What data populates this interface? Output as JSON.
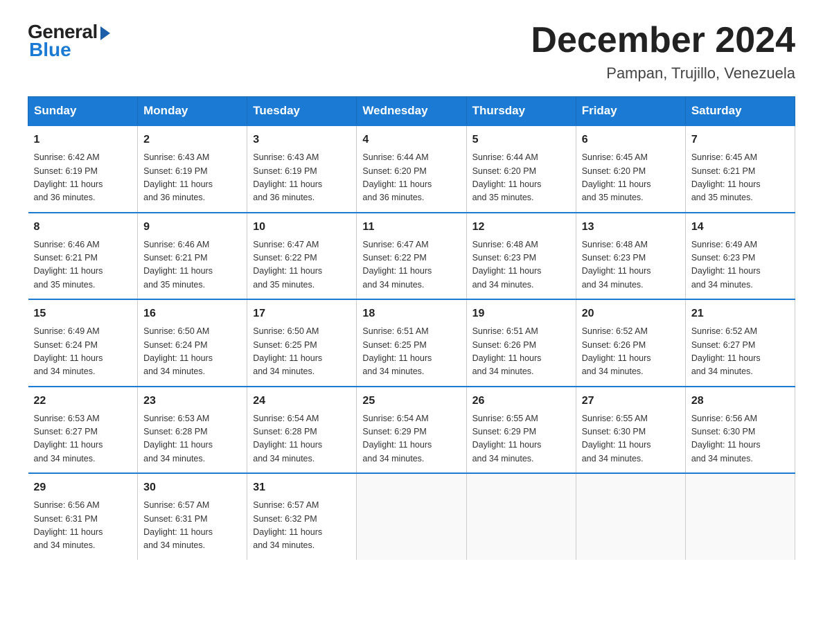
{
  "header": {
    "logo_general": "General",
    "logo_blue": "Blue",
    "month_title": "December 2024",
    "location": "Pampan, Trujillo, Venezuela"
  },
  "calendar": {
    "days_of_week": [
      "Sunday",
      "Monday",
      "Tuesday",
      "Wednesday",
      "Thursday",
      "Friday",
      "Saturday"
    ],
    "weeks": [
      [
        {
          "day": "1",
          "sunrise": "6:42 AM",
          "sunset": "6:19 PM",
          "daylight": "11 hours and 36 minutes."
        },
        {
          "day": "2",
          "sunrise": "6:43 AM",
          "sunset": "6:19 PM",
          "daylight": "11 hours and 36 minutes."
        },
        {
          "day": "3",
          "sunrise": "6:43 AM",
          "sunset": "6:19 PM",
          "daylight": "11 hours and 36 minutes."
        },
        {
          "day": "4",
          "sunrise": "6:44 AM",
          "sunset": "6:20 PM",
          "daylight": "11 hours and 36 minutes."
        },
        {
          "day": "5",
          "sunrise": "6:44 AM",
          "sunset": "6:20 PM",
          "daylight": "11 hours and 35 minutes."
        },
        {
          "day": "6",
          "sunrise": "6:45 AM",
          "sunset": "6:20 PM",
          "daylight": "11 hours and 35 minutes."
        },
        {
          "day": "7",
          "sunrise": "6:45 AM",
          "sunset": "6:21 PM",
          "daylight": "11 hours and 35 minutes."
        }
      ],
      [
        {
          "day": "8",
          "sunrise": "6:46 AM",
          "sunset": "6:21 PM",
          "daylight": "11 hours and 35 minutes."
        },
        {
          "day": "9",
          "sunrise": "6:46 AM",
          "sunset": "6:21 PM",
          "daylight": "11 hours and 35 minutes."
        },
        {
          "day": "10",
          "sunrise": "6:47 AM",
          "sunset": "6:22 PM",
          "daylight": "11 hours and 35 minutes."
        },
        {
          "day": "11",
          "sunrise": "6:47 AM",
          "sunset": "6:22 PM",
          "daylight": "11 hours and 34 minutes."
        },
        {
          "day": "12",
          "sunrise": "6:48 AM",
          "sunset": "6:23 PM",
          "daylight": "11 hours and 34 minutes."
        },
        {
          "day": "13",
          "sunrise": "6:48 AM",
          "sunset": "6:23 PM",
          "daylight": "11 hours and 34 minutes."
        },
        {
          "day": "14",
          "sunrise": "6:49 AM",
          "sunset": "6:23 PM",
          "daylight": "11 hours and 34 minutes."
        }
      ],
      [
        {
          "day": "15",
          "sunrise": "6:49 AM",
          "sunset": "6:24 PM",
          "daylight": "11 hours and 34 minutes."
        },
        {
          "day": "16",
          "sunrise": "6:50 AM",
          "sunset": "6:24 PM",
          "daylight": "11 hours and 34 minutes."
        },
        {
          "day": "17",
          "sunrise": "6:50 AM",
          "sunset": "6:25 PM",
          "daylight": "11 hours and 34 minutes."
        },
        {
          "day": "18",
          "sunrise": "6:51 AM",
          "sunset": "6:25 PM",
          "daylight": "11 hours and 34 minutes."
        },
        {
          "day": "19",
          "sunrise": "6:51 AM",
          "sunset": "6:26 PM",
          "daylight": "11 hours and 34 minutes."
        },
        {
          "day": "20",
          "sunrise": "6:52 AM",
          "sunset": "6:26 PM",
          "daylight": "11 hours and 34 minutes."
        },
        {
          "day": "21",
          "sunrise": "6:52 AM",
          "sunset": "6:27 PM",
          "daylight": "11 hours and 34 minutes."
        }
      ],
      [
        {
          "day": "22",
          "sunrise": "6:53 AM",
          "sunset": "6:27 PM",
          "daylight": "11 hours and 34 minutes."
        },
        {
          "day": "23",
          "sunrise": "6:53 AM",
          "sunset": "6:28 PM",
          "daylight": "11 hours and 34 minutes."
        },
        {
          "day": "24",
          "sunrise": "6:54 AM",
          "sunset": "6:28 PM",
          "daylight": "11 hours and 34 minutes."
        },
        {
          "day": "25",
          "sunrise": "6:54 AM",
          "sunset": "6:29 PM",
          "daylight": "11 hours and 34 minutes."
        },
        {
          "day": "26",
          "sunrise": "6:55 AM",
          "sunset": "6:29 PM",
          "daylight": "11 hours and 34 minutes."
        },
        {
          "day": "27",
          "sunrise": "6:55 AM",
          "sunset": "6:30 PM",
          "daylight": "11 hours and 34 minutes."
        },
        {
          "day": "28",
          "sunrise": "6:56 AM",
          "sunset": "6:30 PM",
          "daylight": "11 hours and 34 minutes."
        }
      ],
      [
        {
          "day": "29",
          "sunrise": "6:56 AM",
          "sunset": "6:31 PM",
          "daylight": "11 hours and 34 minutes."
        },
        {
          "day": "30",
          "sunrise": "6:57 AM",
          "sunset": "6:31 PM",
          "daylight": "11 hours and 34 minutes."
        },
        {
          "day": "31",
          "sunrise": "6:57 AM",
          "sunset": "6:32 PM",
          "daylight": "11 hours and 34 minutes."
        },
        null,
        null,
        null,
        null
      ]
    ]
  }
}
